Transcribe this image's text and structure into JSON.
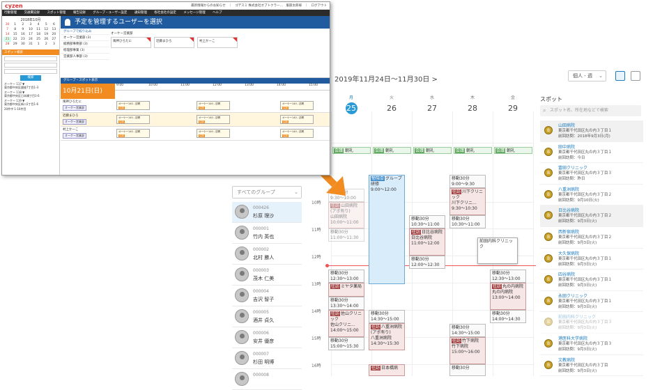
{
  "calendar": {
    "title": "2019年11月24日～11月30日",
    "next_label": ">",
    "view_select": "個人 - 週",
    "group_select": "すべてのグループ",
    "days": [
      {
        "dow": "月",
        "day": "25",
        "today": true
      },
      {
        "dow": "火",
        "day": "26"
      },
      {
        "dow": "水",
        "day": "27"
      },
      {
        "dow": "木",
        "day": "28"
      },
      {
        "dow": "金",
        "day": "29"
      }
    ],
    "allday_tag": "会議",
    "allday_label": "朝礼",
    "hours": [
      "10時",
      "11時",
      "12時",
      "13時",
      "14時",
      "15時",
      "16時"
    ],
    "users": [
      {
        "id": "000426",
        "name": "杉原 理沙"
      },
      {
        "id": "000001",
        "name": "竹内 英也"
      },
      {
        "id": "000002",
        "name": "北村 勝人"
      },
      {
        "id": "000003",
        "name": "茂木 仁美"
      },
      {
        "id": "000004",
        "name": "吉沢 智子"
      },
      {
        "id": "000005",
        "name": "酒井 貞久"
      },
      {
        "id": "000006",
        "name": "安井 優彦"
      },
      {
        "id": "000007",
        "name": "杉田 明博"
      },
      {
        "id": "000008",
        "name": ""
      }
    ],
    "events": {
      "mon_a1": "移動30分",
      "mon_a2": "9:30～10:00",
      "mon_b_tag": "往訪",
      "mon_b1": "山田病院(アポ有り)",
      "mon_b2": "山田病院",
      "mon_b3": "10:00～11:00",
      "mon_c1": "移動30分",
      "mon_c2": "11:00～11:30",
      "mon_d1": "移動30分",
      "mon_d2": "12:30～13:00",
      "mon_e_tag": "往訪",
      "mon_e1": "ミヤタ薬局",
      "mon_f1": "移動30分",
      "mon_f2": "13:30～14:00",
      "mon_g_tag": "往訪",
      "mon_g1": "佐山クリニック",
      "mon_g2": "佐山クリニ...",
      "mon_g3": "14:00～15:00",
      "mon_h1": "移動30分",
      "mon_h2": "15:00～15:30",
      "tue_a_tag": "勉強会",
      "tue_a1": "グループ研修",
      "tue_a2": "9:00～12:00",
      "tue_b1": "移動30分",
      "tue_b2": "14:30～15:00",
      "tue_c_tag": "往訪",
      "tue_c1": "八重洲病院(アポ有り)",
      "tue_c2": "八重洲病院",
      "tue_c3": "14:30～15:30",
      "tue_d_tag": "往訪",
      "tue_d1": "日本橋病",
      "wed_a1": "移動30分",
      "wed_a2": "10:30～11:00",
      "wed_b_tag": "往訪",
      "wed_b1": "日比谷病院",
      "wed_b2": "日比谷病院",
      "wed_b3": "11:00～12:00",
      "wed_c1": "移動30分",
      "wed_c2": "12:00～12:30",
      "thu_a1": "移動30分",
      "thu_a2": "9:00～9:30",
      "thu_b_tag": "往訪",
      "thu_b1": "川下クリニック",
      "thu_b2": "川下クリニ...",
      "thu_b3": "9:30～10:30",
      "thu_c1": "移動30分",
      "thu_c2": "10:30～11:00",
      "thu_d1": "移動30分",
      "thu_d2": "14:30～15:00",
      "thu_e_tag": "往訪",
      "thu_e1": "竹下病院",
      "thu_e2": "竹下病院",
      "thu_e3": "15:00～16:00",
      "thu_f1": "移動30分",
      "float1": "前田内科クリニック",
      "fri_a1": "移動30分",
      "fri_a2": "12:30～13:00",
      "fri_b_tag": "往訪",
      "fri_b1": "丸の内病院",
      "fri_b2": "丸の内病院",
      "fri_b3": "13:00～14:00",
      "fri_c1": "移動30分",
      "fri_c2": "14:00～14:30"
    }
  },
  "spots": {
    "title": "スポット",
    "search_placeholder": "スポット名、所在地などで検索",
    "items": [
      {
        "name": "山田病院",
        "addr": "東京都千代田区丸の内３丁目１",
        "visit": "前回訪問：2018年9月3日(月)"
      },
      {
        "name": "田中病院",
        "addr": "東京都千代田区丸の内３丁目１",
        "visit": "前回訪問：今日"
      },
      {
        "name": "富田クリニック",
        "addr": "東京都千代田区丸の内３丁目３",
        "visit": "前回訪問：昨日"
      },
      {
        "name": "八重洲病院",
        "addr": "東京都千代田区丸の内３丁目２",
        "visit": "前回訪問：9月10日(火)"
      },
      {
        "name": "日比谷病院",
        "addr": "東京都千代田区丸の内３丁目２",
        "visit": "前回訪問：9月3日(火)"
      },
      {
        "name": "西新宿病院",
        "addr": "東京都千代田区丸の内３丁目２",
        "visit": "前回訪問：9月3日(火)"
      },
      {
        "name": "大久保病院",
        "addr": "東京都千代田区丸の内３丁目１",
        "visit": "前回訪問：9月3日(火)"
      },
      {
        "name": "四谷病院",
        "addr": "東京都千代田区丸の内３丁目１",
        "visit": "前回訪問：9月3日(火)"
      },
      {
        "name": "永田クリニック",
        "addr": "東京都千代田区丸の内３丁目１",
        "visit": "前回訪問：9月3日(火)"
      },
      {
        "name": "前田内科クリニック",
        "addr": "東京都千代田区丸の内３丁目３",
        "visit": "前回訪問：9月3日(火)"
      },
      {
        "name": "港医科大学病院",
        "addr": "東京都千代田区丸の内３丁目３",
        "visit": "前回訪問：9月3日(火)"
      },
      {
        "name": "文教病院",
        "addr": "東京都千代田区丸の内３丁目",
        "visit": "前回訪問：9月3日(火)"
      }
    ]
  },
  "inset": {
    "logo": "cyzen",
    "topbar_right": "最新情報からのお知らせ　｜　ゴデスミ 株式会社オプトクラー…　服部太郎様　｜　ログアウト",
    "nav": [
      "行動管理",
      "交通費記録",
      "スポット管理",
      "報告記録",
      "グループ・ユーザー設定",
      "通知管理",
      "各社会社の設定",
      "メッセージ管理",
      "ヘルプ"
    ],
    "mini_cal_title": "2018年10月",
    "spot_bar": "スポット検索",
    "search_btn": "検索",
    "left_items": [
      "オーケー 117 ▼",
      "東京都中央区銀座7丁目1-3",
      "オーケー 118 ▼",
      "東京都中央区日本橋丁目1-6",
      "オーケー 119 ▼",
      "東京都中央区新川1丁目1-6"
    ],
    "left_footer": "20件中 1-10件目",
    "page_title": "予定を管理するユーザーを選択",
    "groups": [
      "グループで絞り込み",
      "オーケー営業部 (3)",
      "総務部事務部 (3)",
      "経理部事業 (3)",
      "営業部人事部 (3)"
    ],
    "group_head": "オーケー営業部",
    "cards": [
      "風神ひろたに",
      "近藤まひろ",
      "村上かーこ"
    ],
    "sched_head": "グループ・スポット表示",
    "sched_date": "10月21日(日)",
    "times": [
      "9:00",
      "10:00",
      "11:00",
      "12:00",
      "13:00",
      "14:00",
      "15:00"
    ],
    "rows": [
      "風神ひろたに",
      "近藤まひろ",
      "村上かーこ"
    ],
    "row_badge": "オーケー営業部",
    "blk_tag": "往訪",
    "blk_text": "オーケー140 - 訪問"
  }
}
